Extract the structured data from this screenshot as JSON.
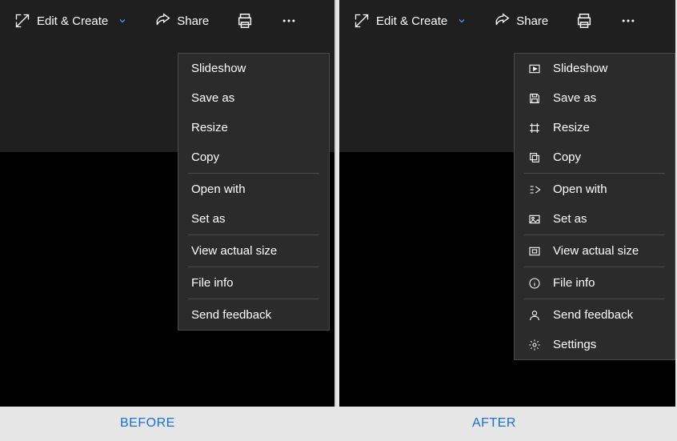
{
  "captions": {
    "before": "BEFORE",
    "after": "AFTER"
  },
  "toolbar": {
    "edit_create": "Edit & Create",
    "share": "Share"
  },
  "menu_before": {
    "slideshow": "Slideshow",
    "save_as": "Save as",
    "resize": "Resize",
    "copy": "Copy",
    "open_with": "Open with",
    "set_as": "Set as",
    "view_actual": "View actual size",
    "file_info": "File info",
    "send_feedback": "Send feedback"
  },
  "menu_after": {
    "slideshow": "Slideshow",
    "save_as": "Save as",
    "resize": "Resize",
    "copy": "Copy",
    "open_with": "Open with",
    "set_as": "Set as",
    "view_actual": "View actual size",
    "file_info": "File info",
    "send_feedback": "Send feedback",
    "settings": "Settings"
  }
}
